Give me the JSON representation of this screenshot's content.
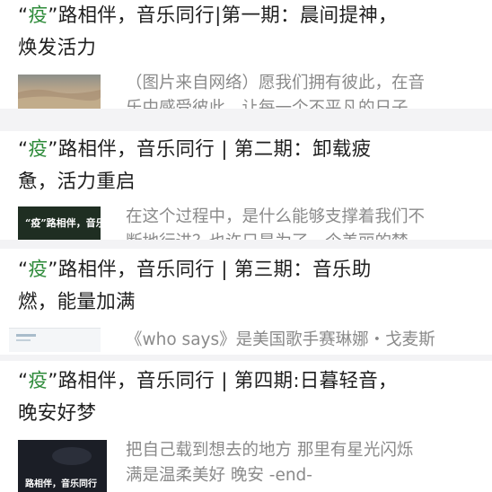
{
  "articles": [
    {
      "quote_open": "“",
      "keyword": "疫",
      "title_rest_1": "”路相伴，音乐同行|第一期：晨间提神，",
      "title_line2": "焕发活力",
      "excerpt_line1": "（图片来自网络）愿我们拥有彼此，在音",
      "excerpt_line2": "乐中感受彼此，让每一个不平凡的日子",
      "thumb_icon": "landscape-thumbnail",
      "thumb_text": ""
    },
    {
      "quote_open": "“",
      "keyword": "疫",
      "title_rest_1": "”路相伴，音乐同行 | 第二期：卸载疲",
      "title_line2": "惫，活力重启",
      "excerpt_line1": "在这个过程中，是什么能够支撑着我们不",
      "excerpt_line2": "断地行进？也许只是为了一个美丽的梦",
      "thumb_icon": "dark-green-cover-thumbnail",
      "thumb_text": "“疫”路相伴，音乐"
    },
    {
      "quote_open": "“",
      "keyword": "疫",
      "title_rest_1": "”路相伴，音乐同行 | 第三期：音乐助",
      "title_line2": "燃，能量加满",
      "excerpt_line1": "《who says》是美国歌手赛琳娜・戈麦斯",
      "excerpt_line2": "",
      "thumb_icon": "light-cover-thumbnail",
      "thumb_text": ""
    },
    {
      "quote_open": "“",
      "keyword": "疫",
      "title_rest_1": "”路相伴，音乐同行 | 第四期:日暮轻音，",
      "title_line2": "晚安好梦",
      "excerpt_line1": "把自己载到想去的地方 那里有星光闪烁",
      "excerpt_line2": "满是温柔美好 晚安 -end-",
      "thumb_icon": "night-cover-thumbnail",
      "thumb_text": "路相伴，音乐同行"
    }
  ]
}
